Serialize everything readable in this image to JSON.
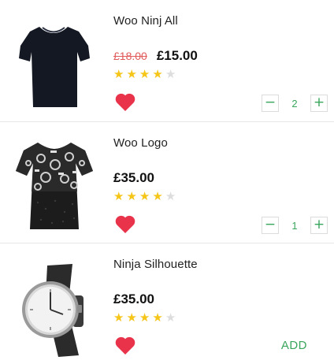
{
  "products": [
    {
      "name": "Woo Ninj All",
      "old_price": "£18.00",
      "price": "£15.00",
      "rating": 4,
      "max_rating": 5,
      "quantity": "2",
      "image": "black-tshirt"
    },
    {
      "name": "Woo Logo",
      "old_price": "",
      "price": "£35.00",
      "rating": 4,
      "max_rating": 5,
      "quantity": "1",
      "image": "patterned-dress"
    },
    {
      "name": "Ninja Silhouette",
      "old_price": "",
      "price": "£35.00",
      "rating": 4,
      "max_rating": 5,
      "add_label": "ADD",
      "image": "wrist-watch"
    }
  ],
  "controls": {
    "minus": "−",
    "plus": "+"
  },
  "icons": {
    "favorite": "heart-icon",
    "star": "star-icon"
  },
  "colors": {
    "accent_green": "#3aa55c",
    "heart_red": "#e8334a",
    "star_gold": "#f5c518",
    "old_price_red": "#e05a5a"
  }
}
